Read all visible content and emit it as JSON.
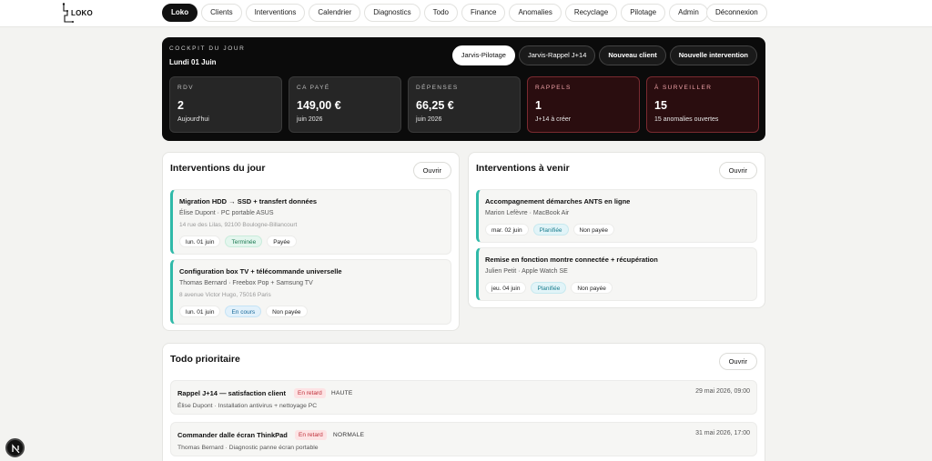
{
  "app": {
    "logo_text": "LOKO"
  },
  "nav": {
    "items": [
      {
        "label": "Loko",
        "active": true
      },
      {
        "label": "Clients"
      },
      {
        "label": "Interventions"
      },
      {
        "label": "Calendrier"
      },
      {
        "label": "Diagnostics"
      },
      {
        "label": "Todo"
      },
      {
        "label": "Finance"
      },
      {
        "label": "Anomalies"
      },
      {
        "label": "Recyclage"
      },
      {
        "label": "Pilotage"
      },
      {
        "label": "Admin"
      }
    ],
    "logout": "Déconnexion"
  },
  "cockpit": {
    "label": "COCKPIT DU JOUR",
    "date": "Lundi 01 Juin",
    "actions": [
      "Jarvis-Pilotage",
      "Jarvis-Rappel J+14",
      "Nouveau client",
      "Nouvelle intervention"
    ],
    "kpis": [
      {
        "label": "RDV",
        "value": "2",
        "sub": "Aujourd'hui"
      },
      {
        "label": "CA PAYÉ",
        "value": "149,00 €",
        "sub": "juin 2026"
      },
      {
        "label": "DÉPENSES",
        "value": "66,25 €",
        "sub": "juin 2026"
      },
      {
        "label": "RAPPELS",
        "value": "1",
        "sub": "J+14 à créer"
      },
      {
        "label": "À SURVEILLER",
        "value": "15",
        "sub": "15 anomalies ouvertes"
      }
    ]
  },
  "today": {
    "title": "Interventions du jour",
    "open": "Ouvrir",
    "cards": [
      {
        "title": "Migration HDD → SSD + transfert données",
        "sub": "Élise Dupont · PC portable ASUS",
        "address": "14 rue des Lilas, 92100 Boulogne-Billancourt",
        "date": "lun. 01 juin",
        "status": "Terminée",
        "payment": "Payée"
      },
      {
        "title": "Configuration box TV + télécommande universelle",
        "sub": "Thomas Bernard · Freebox Pop + Samsung TV",
        "address": "8 avenue Victor Hugo, 75016 Paris",
        "date": "lun. 01 juin",
        "status": "En cours",
        "payment": "Non payée"
      }
    ]
  },
  "upcoming": {
    "title": "Interventions à venir",
    "open": "Ouvrir",
    "cards": [
      {
        "title": "Accompagnement démarches ANTS en ligne",
        "sub": "Marion Lefèvre · MacBook Air",
        "date": "mar. 02 juin",
        "status": "Planifiée",
        "payment": "Non payée"
      },
      {
        "title": "Remise en fonction montre connectée + récupération",
        "sub": "Julien Petit · Apple Watch SE",
        "date": "jeu. 04 juin",
        "status": "Planifiée",
        "payment": "Non payée"
      }
    ]
  },
  "todo": {
    "title": "Todo prioritaire",
    "open": "Ouvrir",
    "items": [
      {
        "title": "Rappel J+14 — satisfaction client",
        "tag": "En retard",
        "priority": "HAUTE",
        "sub": "Élise Dupont · Installation antivirus + nettoyage PC",
        "date": "29 mai 2026, 09:00"
      },
      {
        "title": "Commander dalle écran ThinkPad",
        "tag": "En retard",
        "priority": "NORMALE",
        "sub": "Thomas Bernard · Diagnostic panne écran portable",
        "date": "31 mai 2026, 17:00"
      }
    ]
  },
  "colors": {
    "accent": "#2fb9a8",
    "dark": "#0b0b0b",
    "alert": "#c0313b"
  }
}
